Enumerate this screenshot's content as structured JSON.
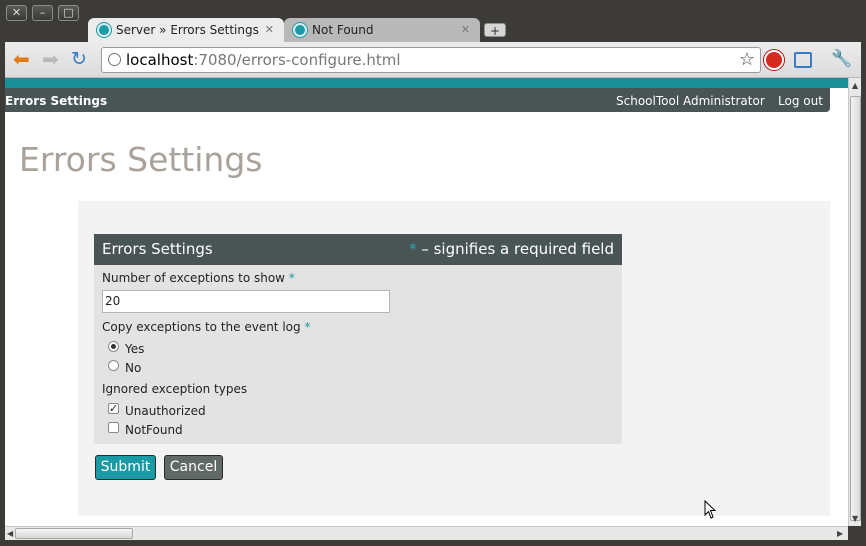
{
  "browser": {
    "tabs": [
      {
        "label": "Server » Errors Settings",
        "active": true
      },
      {
        "label": "Not Found",
        "active": false
      }
    ],
    "url_host": "localhost",
    "url_rest": ":7080/errors-configure.html"
  },
  "topbar": {
    "brand": "Errors Settings",
    "user": "SchoolTool Administrator",
    "logout": "Log out"
  },
  "page": {
    "title": "Errors Settings"
  },
  "form": {
    "legend": "Errors Settings",
    "required_note": "– signifies a required field",
    "required_marker": "*",
    "exceptions_label": "Number of exceptions to show",
    "exceptions_value": "20",
    "copy_label": "Copy exceptions to the event log",
    "copy_options": [
      {
        "label": "Yes",
        "selected": true
      },
      {
        "label": "No",
        "selected": false
      }
    ],
    "ignored_label": "Ignored exception types",
    "ignored_options": [
      {
        "label": "Unauthorized",
        "checked": true
      },
      {
        "label": "NotFound",
        "checked": false
      }
    ],
    "submit_label": "Submit",
    "cancel_label": "Cancel"
  },
  "colors": {
    "accent": "#1a9aa5",
    "header_bar": "#495454",
    "title_text": "#a8a29b"
  }
}
